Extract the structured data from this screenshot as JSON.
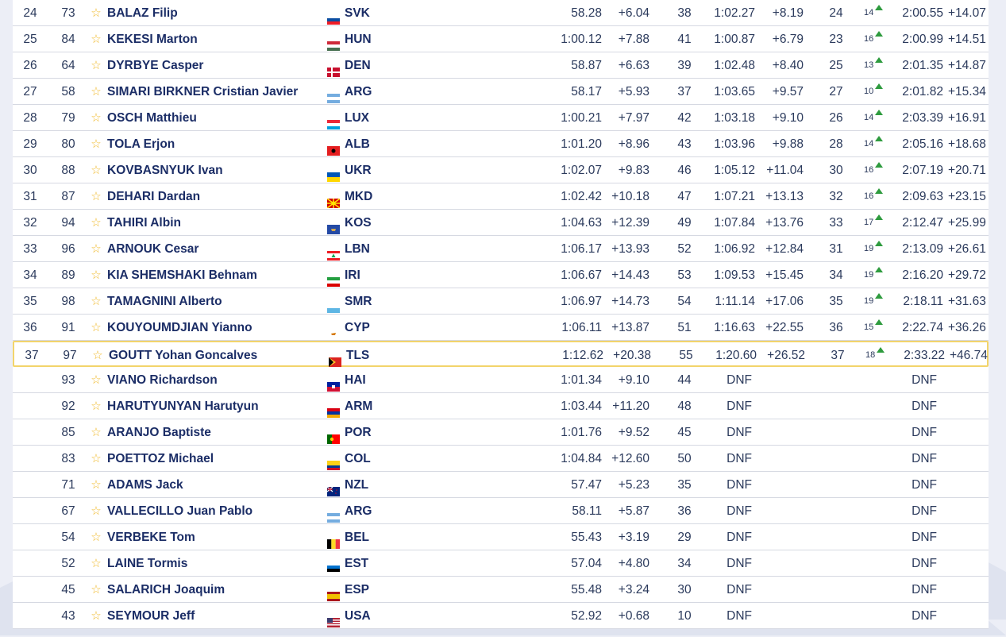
{
  "colors": {
    "accent_star": "#f0b92a",
    "gain_up": "#2e9b3e",
    "highlight_border": "#f2d46b",
    "name_text": "#1b2d66"
  },
  "icons": {
    "favorite": "star-icon",
    "position_up": "arrow-up-icon"
  },
  "rows": [
    {
      "rank": "24",
      "bib": "73",
      "name": "BALAZ Filip",
      "nation": "SVK",
      "flag": "svk",
      "run1": "58.28",
      "diff1": "+6.04",
      "r1rank": "38",
      "run2": "1:02.27",
      "diff2": "+8.19",
      "r2rank": "24",
      "gain": "14",
      "total": "2:00.55",
      "diff3": "+14.07"
    },
    {
      "rank": "25",
      "bib": "84",
      "name": "KEKESI Marton",
      "nation": "HUN",
      "flag": "hun",
      "run1": "1:00.12",
      "diff1": "+7.88",
      "r1rank": "41",
      "run2": "1:00.87",
      "diff2": "+6.79",
      "r2rank": "23",
      "gain": "16",
      "total": "2:00.99",
      "diff3": "+14.51"
    },
    {
      "rank": "26",
      "bib": "64",
      "name": "DYRBYE Casper",
      "nation": "DEN",
      "flag": "den",
      "run1": "58.87",
      "diff1": "+6.63",
      "r1rank": "39",
      "run2": "1:02.48",
      "diff2": "+8.40",
      "r2rank": "25",
      "gain": "13",
      "total": "2:01.35",
      "diff3": "+14.87"
    },
    {
      "rank": "27",
      "bib": "58",
      "name": "SIMARI BIRKNER Cristian Javier",
      "nation": "ARG",
      "flag": "arg",
      "run1": "58.17",
      "diff1": "+5.93",
      "r1rank": "37",
      "run2": "1:03.65",
      "diff2": "+9.57",
      "r2rank": "27",
      "gain": "10",
      "total": "2:01.82",
      "diff3": "+15.34"
    },
    {
      "rank": "28",
      "bib": "79",
      "name": "OSCH Matthieu",
      "nation": "LUX",
      "flag": "lux",
      "run1": "1:00.21",
      "diff1": "+7.97",
      "r1rank": "42",
      "run2": "1:03.18",
      "diff2": "+9.10",
      "r2rank": "26",
      "gain": "14",
      "total": "2:03.39",
      "diff3": "+16.91"
    },
    {
      "rank": "29",
      "bib": "80",
      "name": "TOLA Erjon",
      "nation": "ALB",
      "flag": "alb",
      "run1": "1:01.20",
      "diff1": "+8.96",
      "r1rank": "43",
      "run2": "1:03.96",
      "diff2": "+9.88",
      "r2rank": "28",
      "gain": "14",
      "total": "2:05.16",
      "diff3": "+18.68"
    },
    {
      "rank": "30",
      "bib": "88",
      "name": "KOVBASNYUK Ivan",
      "nation": "UKR",
      "flag": "ukr",
      "run1": "1:02.07",
      "diff1": "+9.83",
      "r1rank": "46",
      "run2": "1:05.12",
      "diff2": "+11.04",
      "r2rank": "30",
      "gain": "16",
      "total": "2:07.19",
      "diff3": "+20.71"
    },
    {
      "rank": "31",
      "bib": "87",
      "name": "DEHARI Dardan",
      "nation": "MKD",
      "flag": "mkd",
      "run1": "1:02.42",
      "diff1": "+10.18",
      "r1rank": "47",
      "run2": "1:07.21",
      "diff2": "+13.13",
      "r2rank": "32",
      "gain": "16",
      "total": "2:09.63",
      "diff3": "+23.15"
    },
    {
      "rank": "32",
      "bib": "94",
      "name": "TAHIRI Albin",
      "nation": "KOS",
      "flag": "kos",
      "run1": "1:04.63",
      "diff1": "+12.39",
      "r1rank": "49",
      "run2": "1:07.84",
      "diff2": "+13.76",
      "r2rank": "33",
      "gain": "17",
      "total": "2:12.47",
      "diff3": "+25.99"
    },
    {
      "rank": "33",
      "bib": "96",
      "name": "ARNOUK Cesar",
      "nation": "LBN",
      "flag": "lbn",
      "run1": "1:06.17",
      "diff1": "+13.93",
      "r1rank": "52",
      "run2": "1:06.92",
      "diff2": "+12.84",
      "r2rank": "31",
      "gain": "19",
      "total": "2:13.09",
      "diff3": "+26.61"
    },
    {
      "rank": "34",
      "bib": "89",
      "name": "KIA SHEMSHAKI Behnam",
      "nation": "IRI",
      "flag": "iri",
      "run1": "1:06.67",
      "diff1": "+14.43",
      "r1rank": "53",
      "run2": "1:09.53",
      "diff2": "+15.45",
      "r2rank": "34",
      "gain": "19",
      "total": "2:16.20",
      "diff3": "+29.72"
    },
    {
      "rank": "35",
      "bib": "98",
      "name": "TAMAGNINI Alberto",
      "nation": "SMR",
      "flag": "smr",
      "run1": "1:06.97",
      "diff1": "+14.73",
      "r1rank": "54",
      "run2": "1:11.14",
      "diff2": "+17.06",
      "r2rank": "35",
      "gain": "19",
      "total": "2:18.11",
      "diff3": "+31.63"
    },
    {
      "rank": "36",
      "bib": "91",
      "name": "KOUYOUMDJIAN Yianno",
      "nation": "CYP",
      "flag": "cyp",
      "run1": "1:06.11",
      "diff1": "+13.87",
      "r1rank": "51",
      "run2": "1:16.63",
      "diff2": "+22.55",
      "r2rank": "36",
      "gain": "15",
      "total": "2:22.74",
      "diff3": "+36.26"
    },
    {
      "rank": "37",
      "bib": "97",
      "name": "GOUTT Yohan Goncalves",
      "nation": "TLS",
      "flag": "tls",
      "run1": "1:12.62",
      "diff1": "+20.38",
      "r1rank": "55",
      "run2": "1:20.60",
      "diff2": "+26.52",
      "r2rank": "37",
      "gain": "18",
      "total": "2:33.22",
      "diff3": "+46.74",
      "highlight": true
    },
    {
      "rank": "",
      "bib": "93",
      "name": "VIANO Richardson",
      "nation": "HAI",
      "flag": "hai",
      "run1": "1:01.34",
      "diff1": "+9.10",
      "r1rank": "44",
      "dnf2": "DNF",
      "dnf3": "DNF"
    },
    {
      "rank": "",
      "bib": "92",
      "name": "HARUTYUNYAN Harutyun",
      "nation": "ARM",
      "flag": "arm",
      "run1": "1:03.44",
      "diff1": "+11.20",
      "r1rank": "48",
      "dnf2": "DNF",
      "dnf3": "DNF"
    },
    {
      "rank": "",
      "bib": "85",
      "name": "ARANJO Baptiste",
      "nation": "POR",
      "flag": "por",
      "run1": "1:01.76",
      "diff1": "+9.52",
      "r1rank": "45",
      "dnf2": "DNF",
      "dnf3": "DNF"
    },
    {
      "rank": "",
      "bib": "83",
      "name": "POETTOZ Michael",
      "nation": "COL",
      "flag": "col",
      "run1": "1:04.84",
      "diff1": "+12.60",
      "r1rank": "50",
      "dnf2": "DNF",
      "dnf3": "DNF"
    },
    {
      "rank": "",
      "bib": "71",
      "name": "ADAMS Jack",
      "nation": "NZL",
      "flag": "nzl",
      "run1": "57.47",
      "diff1": "+5.23",
      "r1rank": "35",
      "dnf2": "DNF",
      "dnf3": "DNF"
    },
    {
      "rank": "",
      "bib": "67",
      "name": "VALLECILLO Juan Pablo",
      "nation": "ARG",
      "flag": "arg",
      "run1": "58.11",
      "diff1": "+5.87",
      "r1rank": "36",
      "dnf2": "DNF",
      "dnf3": "DNF"
    },
    {
      "rank": "",
      "bib": "54",
      "name": "VERBEKE Tom",
      "nation": "BEL",
      "flag": "bel",
      "run1": "55.43",
      "diff1": "+3.19",
      "r1rank": "29",
      "dnf2": "DNF",
      "dnf3": "DNF"
    },
    {
      "rank": "",
      "bib": "52",
      "name": "LAINE Tormis",
      "nation": "EST",
      "flag": "est",
      "run1": "57.04",
      "diff1": "+4.80",
      "r1rank": "34",
      "dnf2": "DNF",
      "dnf3": "DNF"
    },
    {
      "rank": "",
      "bib": "45",
      "name": "SALARICH Joaquim",
      "nation": "ESP",
      "flag": "esp",
      "run1": "55.48",
      "diff1": "+3.24",
      "r1rank": "30",
      "dnf2": "DNF",
      "dnf3": "DNF"
    },
    {
      "rank": "",
      "bib": "43",
      "name": "SEYMOUR Jeff",
      "nation": "USA",
      "flag": "usa",
      "run1": "52.92",
      "diff1": "+0.68",
      "r1rank": "10",
      "dnf2": "DNF",
      "dnf3": "DNF"
    }
  ]
}
